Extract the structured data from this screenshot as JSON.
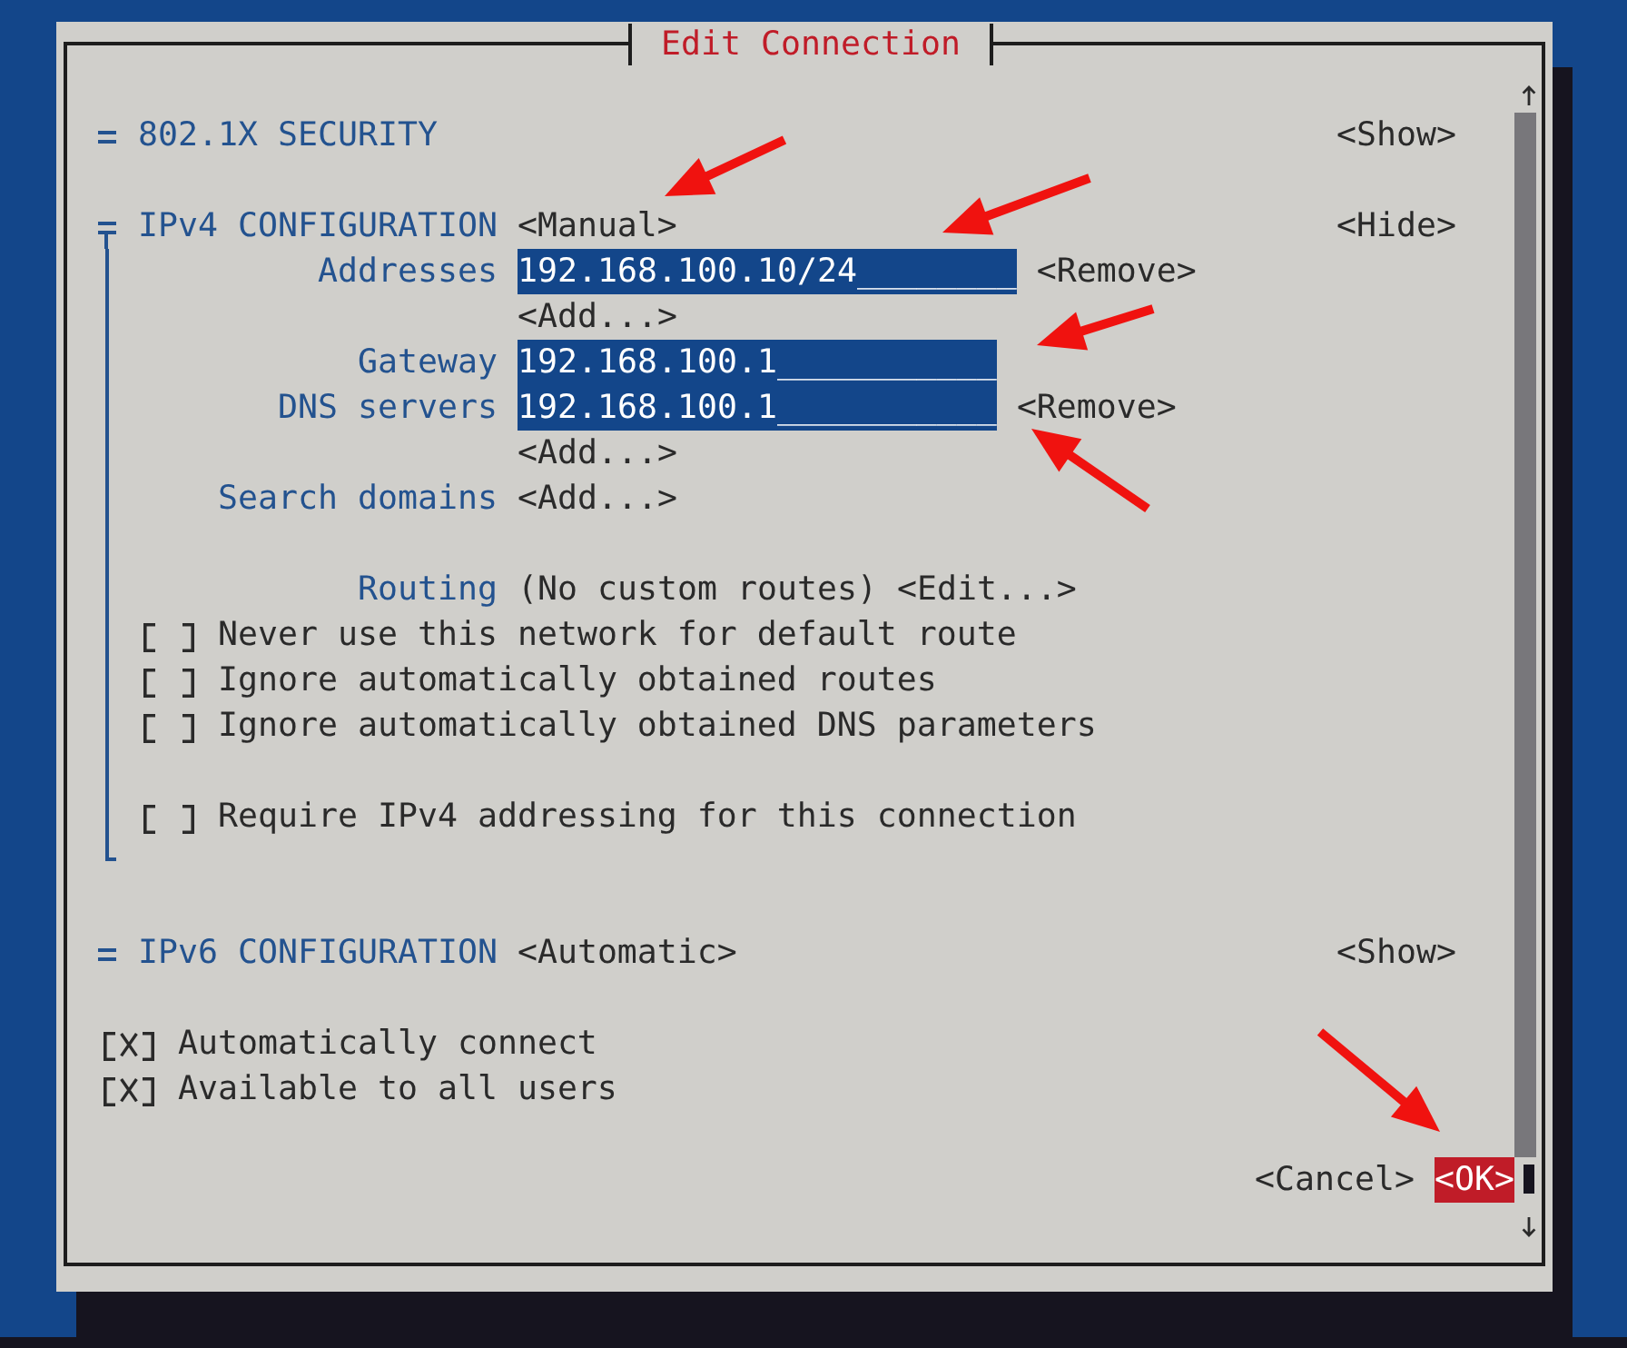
{
  "window": {
    "title": "Edit Connection"
  },
  "sections": [
    {
      "title": "802.1X SECURITY",
      "toggle": "<Show>",
      "expanded": false
    },
    {
      "title": "IPv4 CONFIGURATION",
      "mode": "<Manual>",
      "toggle": "<Hide>",
      "expanded": true,
      "rows": [
        {
          "kind": "field",
          "label": "Addresses",
          "value": "192.168.100.10/24________",
          "remove": "<Remove>"
        },
        {
          "kind": "add",
          "add": "<Add...>"
        },
        {
          "kind": "field",
          "label": "Gateway",
          "value": "192.168.100.1___________"
        },
        {
          "kind": "field",
          "label": "DNS servers",
          "value": "192.168.100.1___________",
          "remove": "<Remove>"
        },
        {
          "kind": "add",
          "add": "<Add...>"
        },
        {
          "kind": "add",
          "label": "Search domains",
          "add": "<Add...>"
        },
        {
          "kind": "spacer"
        },
        {
          "kind": "routing",
          "label": "Routing",
          "summary": "(No custom routes)",
          "edit": "<Edit...>"
        },
        {
          "kind": "checkbox",
          "label": "Never use this network for default route",
          "checked": false
        },
        {
          "kind": "checkbox",
          "label": "Ignore automatically obtained routes",
          "checked": false
        },
        {
          "kind": "checkbox",
          "label": "Ignore automatically obtained DNS parameters",
          "checked": false
        },
        {
          "kind": "spacer"
        },
        {
          "kind": "checkbox",
          "label": "Require IPv4 addressing for this connection",
          "checked": false
        }
      ]
    },
    {
      "title": "IPv6 CONFIGURATION",
      "mode": "<Automatic>",
      "toggle": "<Show>",
      "expanded": false
    }
  ],
  "options": [
    {
      "label": "Automatically connect",
      "checked": true
    },
    {
      "label": "Available to all users",
      "checked": true
    }
  ],
  "buttons": [
    {
      "label": "<Cancel>",
      "selected": false
    },
    {
      "label": "<OK>",
      "selected": true
    }
  ]
}
